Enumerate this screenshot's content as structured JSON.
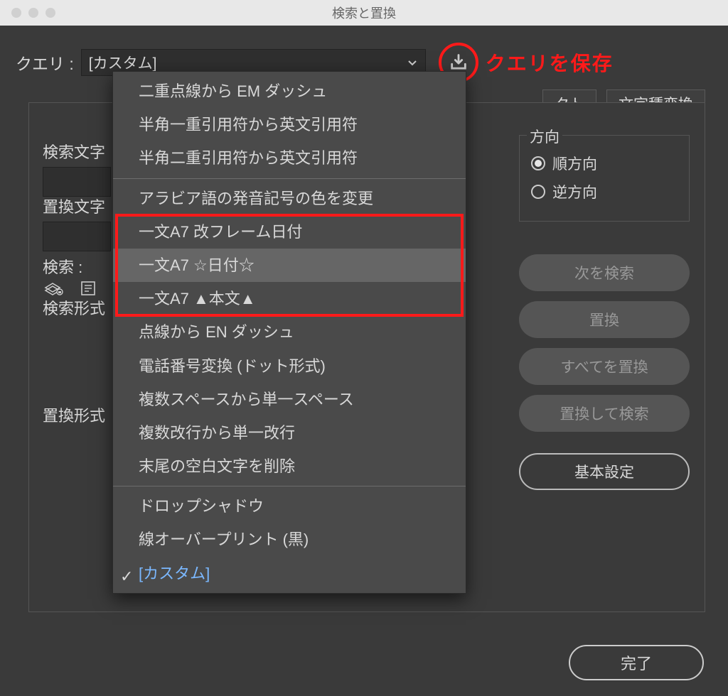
{
  "window": {
    "title": "検索と置換"
  },
  "query": {
    "label": "クエリ :",
    "selected": "[カスタム]"
  },
  "annotation": {
    "save_query": "クエリを保存"
  },
  "tabs": {
    "object": "クト",
    "glyph_conversion": "文字種変換"
  },
  "left": {
    "find_string": "検索文字",
    "replace_string": "置換文字",
    "search": "検索 :",
    "find_format": "検索形式",
    "replace_format": "置換形式"
  },
  "direction": {
    "title": "方向",
    "forward": "順方向",
    "backward": "逆方向",
    "selected": "forward"
  },
  "buttons": {
    "find_next": "次を検索",
    "change": "置換",
    "change_all": "すべてを置換",
    "change_find": "置換して検索",
    "basic_settings": "基本設定",
    "done": "完了"
  },
  "dropdown": {
    "items": [
      {
        "label": "二重点線から EM ダッシュ"
      },
      {
        "label": "半角一重引用符から英文引用符"
      },
      {
        "label": "半角二重引用符から英文引用符"
      },
      {
        "sep": true
      },
      {
        "label": "アラビア語の発音記号の色を変更"
      },
      {
        "label": "一文A7 改フレーム日付",
        "boxed": true
      },
      {
        "label": "一文A7 ☆日付☆",
        "highlight": true,
        "boxed": true
      },
      {
        "label": "一文A7 ▲本文▲",
        "boxed": true
      },
      {
        "label": "点線から EN ダッシュ"
      },
      {
        "label": "電話番号変換 (ドット形式)"
      },
      {
        "label": "複数スペースから単一スペース"
      },
      {
        "label": "複数改行から単一改行"
      },
      {
        "label": "末尾の空白文字を削除"
      },
      {
        "sep": true
      },
      {
        "label": "ドロップシャドウ"
      },
      {
        "label": "線オーバープリント (黒)"
      },
      {
        "label": "[カスタム]",
        "checked": true,
        "custom": true
      }
    ]
  }
}
